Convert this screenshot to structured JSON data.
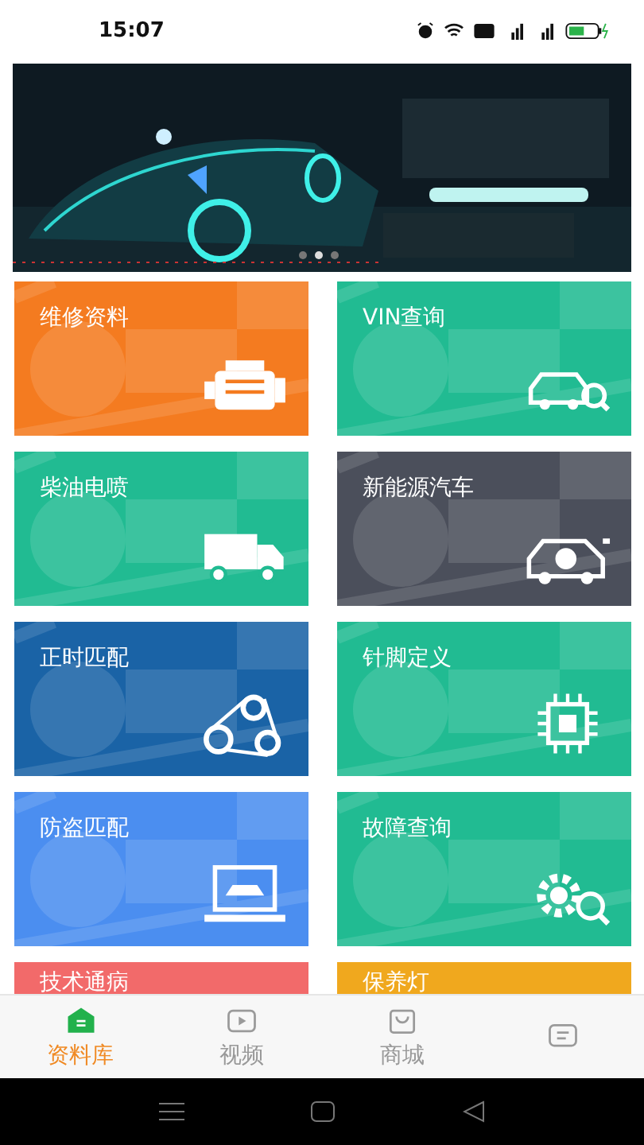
{
  "status_bar": {
    "time": "15:07"
  },
  "banner": {
    "kind": "picture",
    "pages": [
      {
        "selected": false
      },
      {
        "selected": true
      },
      {
        "selected": false
      }
    ]
  },
  "tiles": [
    {
      "title": "维修资料",
      "color": "#f47b20",
      "kind": "engine"
    },
    {
      "title": "VIN查询",
      "color": "#21bb92",
      "kind": "car-search"
    },
    {
      "title": "柴油电喷",
      "color": "#21bb92",
      "kind": "truck"
    },
    {
      "title": "新能源汽车",
      "color": "#4b4f5b",
      "kind": "ev"
    },
    {
      "title": "正时匹配",
      "color": "#1a63a6",
      "kind": "belt"
    },
    {
      "title": "针脚定义",
      "color": "#21bb92",
      "kind": "chip"
    },
    {
      "title": "防盗匹配",
      "color": "#4b8ef0",
      "kind": "laptop"
    },
    {
      "title": "故障查询",
      "color": "#21bb92",
      "kind": "gear-search"
    },
    {
      "title": "技术通病",
      "color": "#f26a6a",
      "kind": "none"
    },
    {
      "title": "保养灯",
      "color": "#f0a81e",
      "kind": "none"
    }
  ],
  "tabs": [
    {
      "label": "资料库",
      "selected": true,
      "kind": "home"
    },
    {
      "label": "视频",
      "selected": false,
      "kind": "video"
    },
    {
      "label": "商城",
      "selected": false,
      "kind": "bag"
    },
    {
      "selected": false,
      "kind": "message"
    }
  ]
}
